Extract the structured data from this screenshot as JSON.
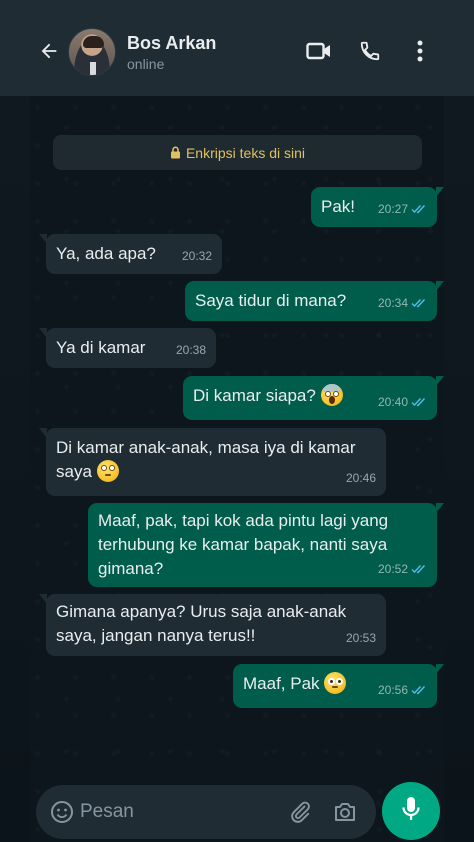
{
  "header": {
    "contact_name": "Bos Arkan",
    "status": "online",
    "icons": [
      "back-arrow-icon",
      "video-call-icon",
      "phone-icon",
      "more-options-icon"
    ]
  },
  "encryption_notice": "Enkripsi teks di sini",
  "messages": [
    {
      "direction": "out",
      "text": "Pak!",
      "time": "20:27",
      "read": true
    },
    {
      "direction": "in",
      "text": "Ya, ada apa?",
      "time": "20:32"
    },
    {
      "direction": "out",
      "text": "Saya tidur di mana?",
      "time": "20:34",
      "read": true
    },
    {
      "direction": "in",
      "text": "Ya di kamar",
      "time": "20:38"
    },
    {
      "direction": "out",
      "text": "Di kamar siapa?",
      "emoji": "screaming-face",
      "time": "20:40",
      "read": true
    },
    {
      "direction": "in",
      "line1": "Di kamar anak-anak, masa iya di kamar",
      "line2": "saya",
      "emoji": "eye-roll-face",
      "time": "20:46"
    },
    {
      "direction": "out",
      "line1": "Maaf, pak, tapi kok ada pintu lagi yang",
      "line2": "terhubung ke kamar bapak, nanti saya",
      "line3": "gimana?",
      "time": "20:52",
      "read": true
    },
    {
      "direction": "in",
      "line1": "Gimana apanya? Urus saja anak-anak",
      "line2": "saya, jangan nanya terus!!",
      "time": "20:53"
    },
    {
      "direction": "out",
      "text": "Maaf, Pak",
      "emoji": "pleading-face",
      "time": "20:56",
      "read": true
    }
  ],
  "input": {
    "placeholder": "Pesan",
    "icons": [
      "emoji-icon",
      "attach-icon",
      "camera-icon",
      "mic-icon"
    ]
  },
  "colors": {
    "background": "#0b141a",
    "header": "#1f2c33",
    "incoming_bubble": "#1f2c34",
    "outgoing_bubble": "#005c4b",
    "accent": "#00a884",
    "read_tick": "#53bdeb",
    "encryption_text": "#e0c060"
  }
}
